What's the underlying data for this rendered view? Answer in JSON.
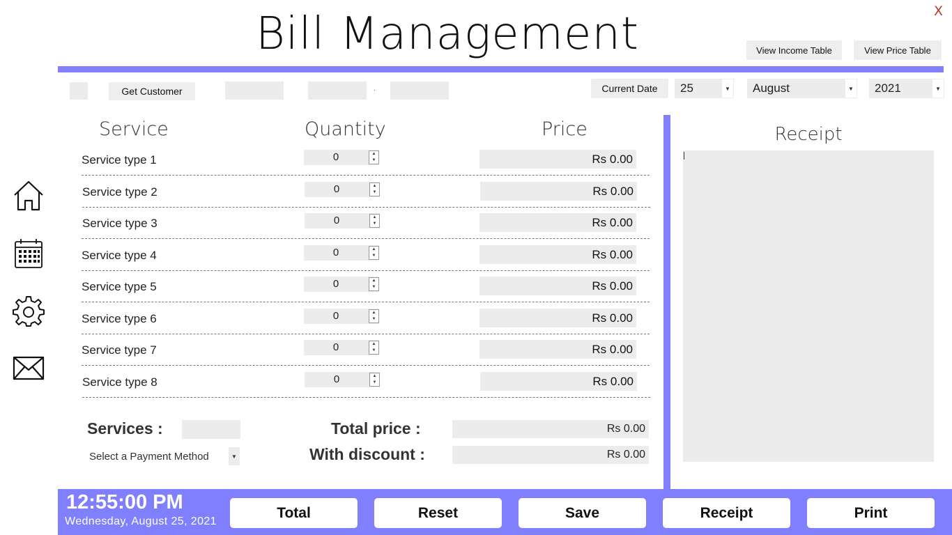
{
  "app": {
    "title": "Bill Management",
    "close_label": "X",
    "view_income_label": "View Income Table",
    "view_price_label": "View Price Table"
  },
  "customer": {
    "get_customer_label": "Get Customer",
    "separator": "."
  },
  "date": {
    "current_date_label": "Current Date",
    "day": "25",
    "month": "August",
    "year": "2021"
  },
  "table": {
    "headers": {
      "service": "Service",
      "quantity": "Quantity",
      "price": "Price"
    },
    "rows": [
      {
        "service": "Service type 1",
        "quantity": "0",
        "price": "Rs 0.00"
      },
      {
        "service": "Service type 2",
        "quantity": "0",
        "price": "Rs 0.00"
      },
      {
        "service": "Service type 3",
        "quantity": "0",
        "price": "Rs 0.00"
      },
      {
        "service": "Service type 4",
        "quantity": "0",
        "price": "Rs 0.00"
      },
      {
        "service": "Service type 5",
        "quantity": "0",
        "price": "Rs 0.00"
      },
      {
        "service": "Service type 6",
        "quantity": "0",
        "price": "Rs 0.00"
      },
      {
        "service": "Service type 7",
        "quantity": "0",
        "price": "Rs 0.00"
      },
      {
        "service": "Service type 8",
        "quantity": "0",
        "price": "Rs 0.00"
      }
    ]
  },
  "summary": {
    "services_label": "Services :",
    "total_price_label": "Total price   :",
    "with_discount_label": "With discount   :",
    "total_price_value": "Rs 0.00",
    "with_discount_value": "Rs 0.00",
    "payment_method_placeholder": "Select a Payment Method"
  },
  "receipt": {
    "title": "Receipt"
  },
  "nav": {
    "icons": [
      "home-icon",
      "calendar-icon",
      "gear-icon",
      "mail-icon"
    ]
  },
  "footer": {
    "time": "12:55:00 PM",
    "date_long": "Wednesday, August 25, 2021",
    "buttons": {
      "total": "Total",
      "reset": "Reset",
      "save": "Save",
      "receipt": "Receipt",
      "print": "Print"
    }
  },
  "colors": {
    "accent": "#8080ff",
    "field_bg": "#ececec",
    "close": "#c0392b"
  }
}
